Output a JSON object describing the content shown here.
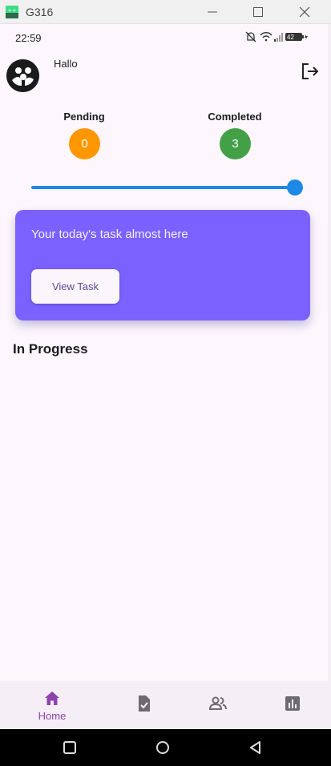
{
  "window": {
    "title": "G316"
  },
  "status_bar": {
    "time": "22:59",
    "battery": "42"
  },
  "header": {
    "greeting": "Hallo"
  },
  "counters": {
    "pending": {
      "label": "Pending",
      "value": "0",
      "color": "#ff9800"
    },
    "completed": {
      "label": "Completed",
      "value": "3",
      "color": "#43a047"
    }
  },
  "progress_slider": {
    "value": 1.0
  },
  "task_card": {
    "message": "Your today's task almost here",
    "button_label": "View Task",
    "color": "#7b61ff"
  },
  "section": {
    "title": "In Progress"
  },
  "bottom_nav": {
    "items": [
      {
        "label": "Home",
        "icon": "home-icon",
        "active": true
      },
      {
        "label": "",
        "icon": "task-doc-icon"
      },
      {
        "label": "",
        "icon": "people-icon"
      },
      {
        "label": "",
        "icon": "bar-chart-icon"
      }
    ],
    "accent": "#8e44ad"
  }
}
